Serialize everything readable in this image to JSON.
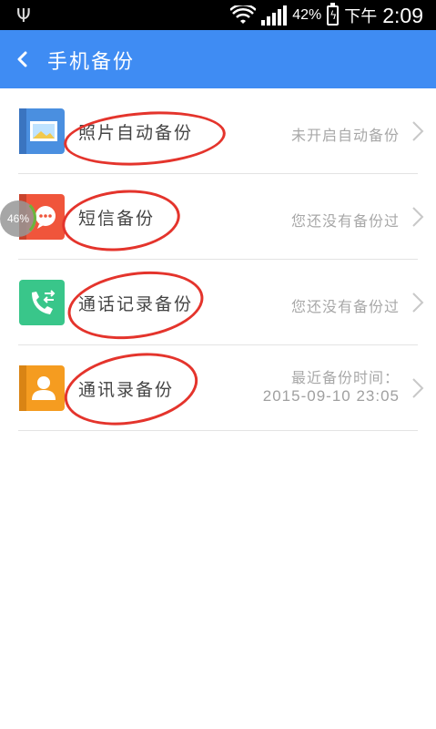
{
  "status_bar": {
    "battery_percent": "42%",
    "ampm": "下午",
    "time": "2:09"
  },
  "app_bar": {
    "title": "手机备份",
    "back_icon": "chevron-left-icon"
  },
  "items": [
    {
      "label": "照片自动备份",
      "status": "未开启自动备份",
      "icon": "photo-icon",
      "color": "#4a8fe0"
    },
    {
      "label": "短信备份",
      "status": "您还没有备份过",
      "icon": "message-icon",
      "color": "#f0553b"
    },
    {
      "label": "通话记录备份",
      "status": "您还没有备份过",
      "icon": "phone-transfer-icon",
      "color": "#39c68a"
    },
    {
      "label": "通讯录备份",
      "status_line1": "最近备份时间：",
      "status_line2": "2015-09-10 23:05",
      "icon": "contact-icon",
      "color": "#f59c20"
    }
  ],
  "floating_bubble": {
    "text": "46%"
  },
  "annotation_color": "#e4342c"
}
